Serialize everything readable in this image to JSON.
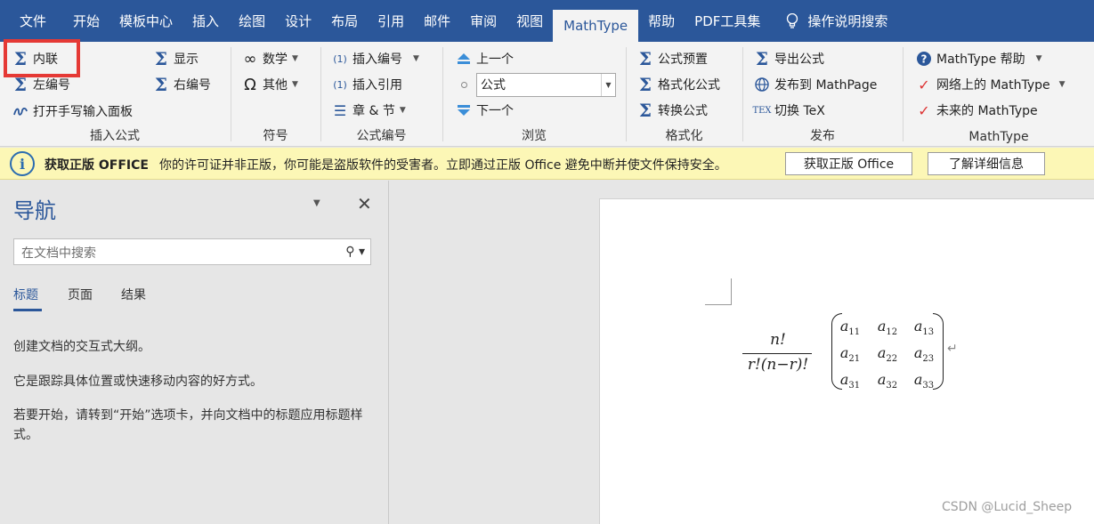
{
  "tabs": [
    "文件",
    "开始",
    "模板中心",
    "插入",
    "绘图",
    "设计",
    "布局",
    "引用",
    "邮件",
    "审阅",
    "视图",
    "MathType",
    "帮助",
    "PDF工具集",
    "操作说明搜索"
  ],
  "ribbon": {
    "insert_formula": {
      "label": "插入公式",
      "inline": "内联",
      "display": "显示",
      "left_number": "左编号",
      "right_number": "右编号",
      "handwriting": "打开手写输入面板"
    },
    "symbols": {
      "label": "符号",
      "math": "数学",
      "other": "其他"
    },
    "numbering": {
      "label": "公式编号",
      "insert_number": "插入编号",
      "insert_ref": "插入引用",
      "chapter": "章 & 节"
    },
    "browse": {
      "label": "浏览",
      "prev": "上一个",
      "combo_value": "公式",
      "next": "下一个"
    },
    "format": {
      "label": "格式化",
      "presets": "公式预置",
      "format_eq": "格式化公式",
      "convert": "转换公式"
    },
    "publish": {
      "label": "发布",
      "export": "导出公式",
      "to_mathpage": "发布到 MathPage",
      "toggle_tex": "切换 TeX"
    },
    "mathtype": {
      "label": "MathType",
      "help": "MathType 帮助",
      "online": "网络上的 MathType",
      "future": "未来的 MathType"
    }
  },
  "infobar": {
    "title": "获取正版 OFFICE",
    "message": "你的许可证并非正版，你可能是盗版软件的受害者。立即通过正版 Office 避免中断并使文件保持安全。",
    "button_get": "获取正版 Office",
    "button_learn": "了解详细信息"
  },
  "nav": {
    "title": "导航",
    "search_placeholder": "在文档中搜索",
    "tabs": [
      "标题",
      "页面",
      "结果"
    ],
    "p1": "创建文档的交互式大纲。",
    "p2": "它是跟踪具体位置或快速移动内容的好方式。",
    "p3": "若要开始，请转到“开始”选项卡，并向文档中的标题应用标题样式。"
  },
  "doc": {
    "frac_num": "n!",
    "frac_den": "r!(n−r)!",
    "matrix": [
      [
        "a",
        "11"
      ],
      [
        "a",
        "12"
      ],
      [
        "a",
        "13"
      ],
      [
        "a",
        "21"
      ],
      [
        "a",
        "22"
      ],
      [
        "a",
        "23"
      ],
      [
        "a",
        "31"
      ],
      [
        "a",
        "32"
      ],
      [
        "a",
        "33"
      ]
    ],
    "para_mark": "↵"
  },
  "watermark": "CSDN @Lucid_Sheep",
  "colors": {
    "accent": "#2b579a",
    "highlight": "#e53935",
    "infobar": "#fcf7b6"
  }
}
